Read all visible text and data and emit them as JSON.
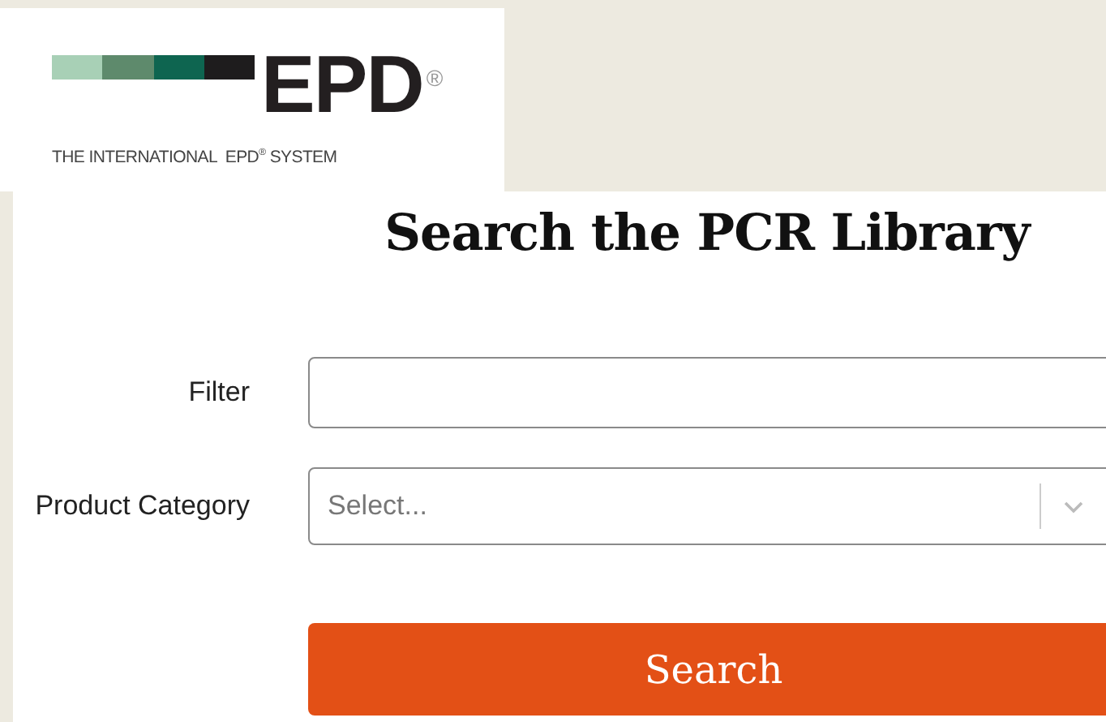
{
  "logo": {
    "wordmark": "EPD$^{®}$",
    "tagline": "THE INTERNATIONAL  EPD$^{®}$ SYSTEM"
  },
  "title": "Search the PCR Library",
  "fields": [
    {
      "kind": "text",
      "label": "Filter"
    },
    {
      "kind": "select",
      "label": "Product Category",
      "placeholder": "Select..."
    }
  ],
  "button": "Search"
}
